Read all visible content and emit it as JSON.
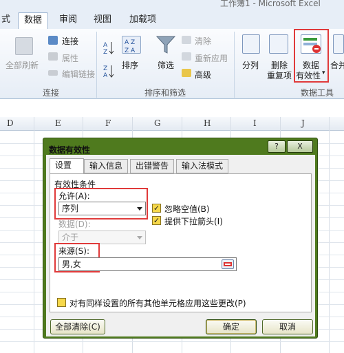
{
  "app_title": "工作簿1 - Microsoft Excel",
  "tabs": [
    {
      "label": "式"
    },
    {
      "label": "数据"
    },
    {
      "label": "审阅"
    },
    {
      "label": "视图"
    },
    {
      "label": "加载项"
    }
  ],
  "ribbon": {
    "connections": {
      "refresh_all": "全部刷新",
      "connections": "连接",
      "properties": "属性",
      "edit_links": "编辑链接",
      "group_label": "连接"
    },
    "sort_filter": {
      "sort": "排序",
      "filter": "筛选",
      "clear": "清除",
      "reapply": "重新应用",
      "advanced": "高级",
      "group_label": "排序和筛选"
    },
    "data_tools": {
      "text_to_columns": "分列",
      "remove_duplicates_line1": "删除",
      "remove_duplicates_line2": "重复项",
      "data_validation_line1": "数据",
      "data_validation_line2": "有效性",
      "consolidate": "合并",
      "group_label": "数据工具"
    }
  },
  "columns": [
    "D",
    "E",
    "F",
    "G",
    "H",
    "I",
    "J"
  ],
  "dialog": {
    "title": "数据有效性",
    "help_button": "?",
    "close_button": "X",
    "tabs": [
      "设置",
      "输入信息",
      "出错警告",
      "输入法模式"
    ],
    "section_label": "有效性条件",
    "allow_label": "允许(A):",
    "allow_value": "序列",
    "data_label": "数据(D):",
    "data_value": "介于",
    "ignore_blank": "忽略空值(B)",
    "dropdown_arrow": "提供下拉箭头(I)",
    "source_label": "来源(S):",
    "source_value": "男,女",
    "apply_all": "对有同样设置的所有其他单元格应用这些更改(P)",
    "clear_all": "全部清除(C)",
    "ok": "确定",
    "cancel": "取消"
  }
}
